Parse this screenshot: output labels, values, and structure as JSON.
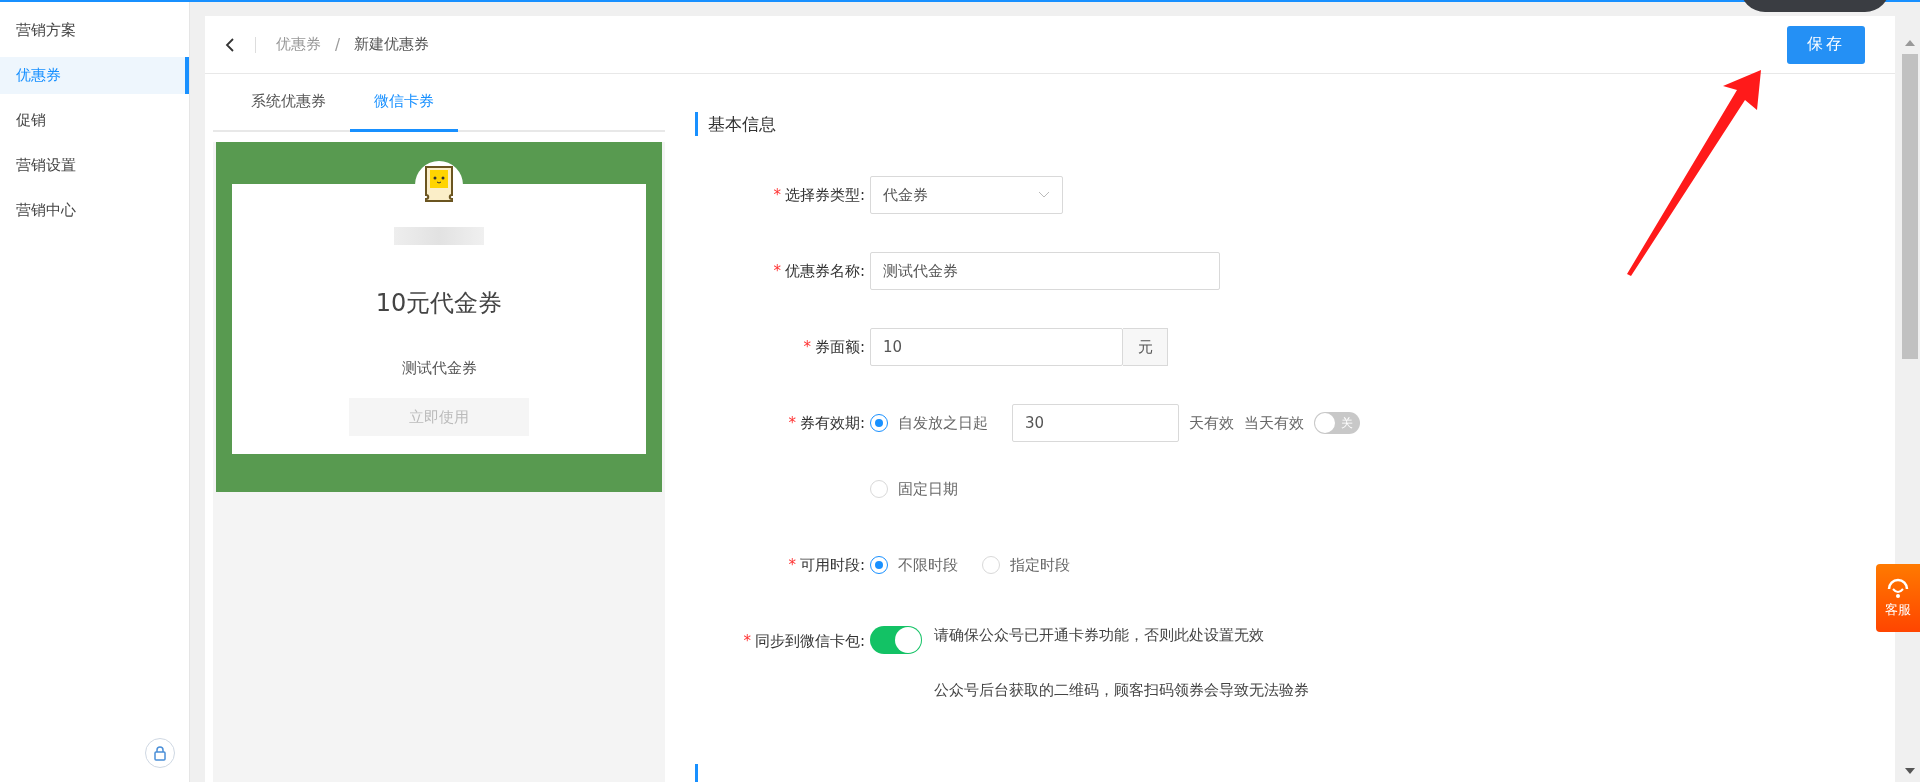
{
  "sidebar": {
    "items": [
      {
        "label": "营销方案",
        "selected": false
      },
      {
        "label": "优惠券",
        "selected": true
      },
      {
        "label": "促销",
        "selected": false
      },
      {
        "label": "营销设置",
        "selected": false
      },
      {
        "label": "营销中心",
        "selected": false
      }
    ]
  },
  "header": {
    "breadcrumb": [
      {
        "label": "优惠券",
        "current": false
      },
      {
        "label": "新建优惠券",
        "current": true
      }
    ],
    "separator": "/",
    "save_button": "保存"
  },
  "preview_tabs": [
    {
      "label": "系统优惠券",
      "selected": false
    },
    {
      "label": "微信卡券",
      "selected": true
    }
  ],
  "preview": {
    "amount_title": "10元代金券",
    "coupon_name": "测试代金券",
    "use_button": "立即使用"
  },
  "section": {
    "title": "基本信息"
  },
  "form": [
    {
      "kind": "select",
      "required": "*",
      "label": "选择券类型:",
      "value": "代金券"
    },
    {
      "kind": "text",
      "required": "*",
      "label": "优惠券名称:",
      "value": "测试代金券"
    },
    {
      "kind": "unit",
      "required": "*",
      "label": "券面额:",
      "value": "10",
      "unit": "元"
    },
    {
      "kind": "validity",
      "required": "*",
      "label": "券有效期:",
      "options": [
        {
          "label": "自发放之日起",
          "selected": true,
          "days": "30",
          "suffix": "天有效",
          "same_day_label": "当天有效",
          "same_day_switch": {
            "on": false,
            "text": "关"
          }
        },
        {
          "label": "固定日期",
          "selected": false
        }
      ]
    },
    {
      "kind": "radios",
      "required": "*",
      "label": "可用时段:",
      "options": [
        {
          "label": "不限时段",
          "selected": true
        },
        {
          "label": "指定时段",
          "selected": false
        }
      ]
    },
    {
      "kind": "switch",
      "required": "*",
      "label": "同步到微信卡包:",
      "on": true,
      "notes": [
        "请确保公众号已开通卡券功能，否则此处设置无效",
        "公众号后台获取的二维码，顾客扫码领券会导致无法验券"
      ]
    }
  ],
  "service_badge": {
    "label": "客服"
  }
}
